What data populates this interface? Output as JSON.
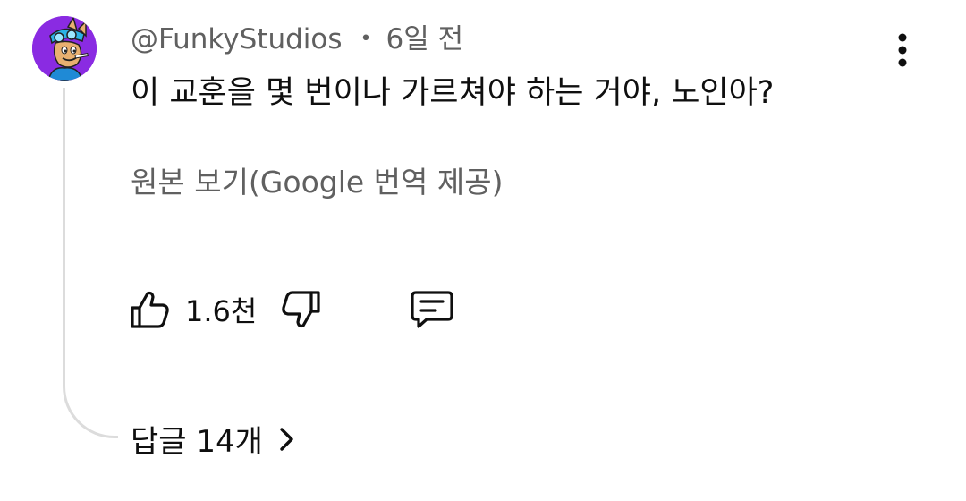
{
  "comment": {
    "author": "@FunkyStudios",
    "separator": "•",
    "time_ago": "6일 전",
    "text": "이 교훈을 몇 번이나 가르쳐야 하는 거야, 노인아?",
    "translation_link": "원본 보기(Google 번역 제공)",
    "like_count": "1.6천",
    "replies_label": "답글 14개"
  },
  "icons": {
    "like": "thumbs-up-icon",
    "dislike": "thumbs-down-icon",
    "reply": "comment-icon",
    "more": "more-vert-icon",
    "expand": "chevron-right-icon"
  },
  "colors": {
    "avatar_bg": "#8a2be2",
    "text_primary": "#0f0f0f",
    "text_secondary": "#606060",
    "thread_line": "#dcdcdc"
  }
}
